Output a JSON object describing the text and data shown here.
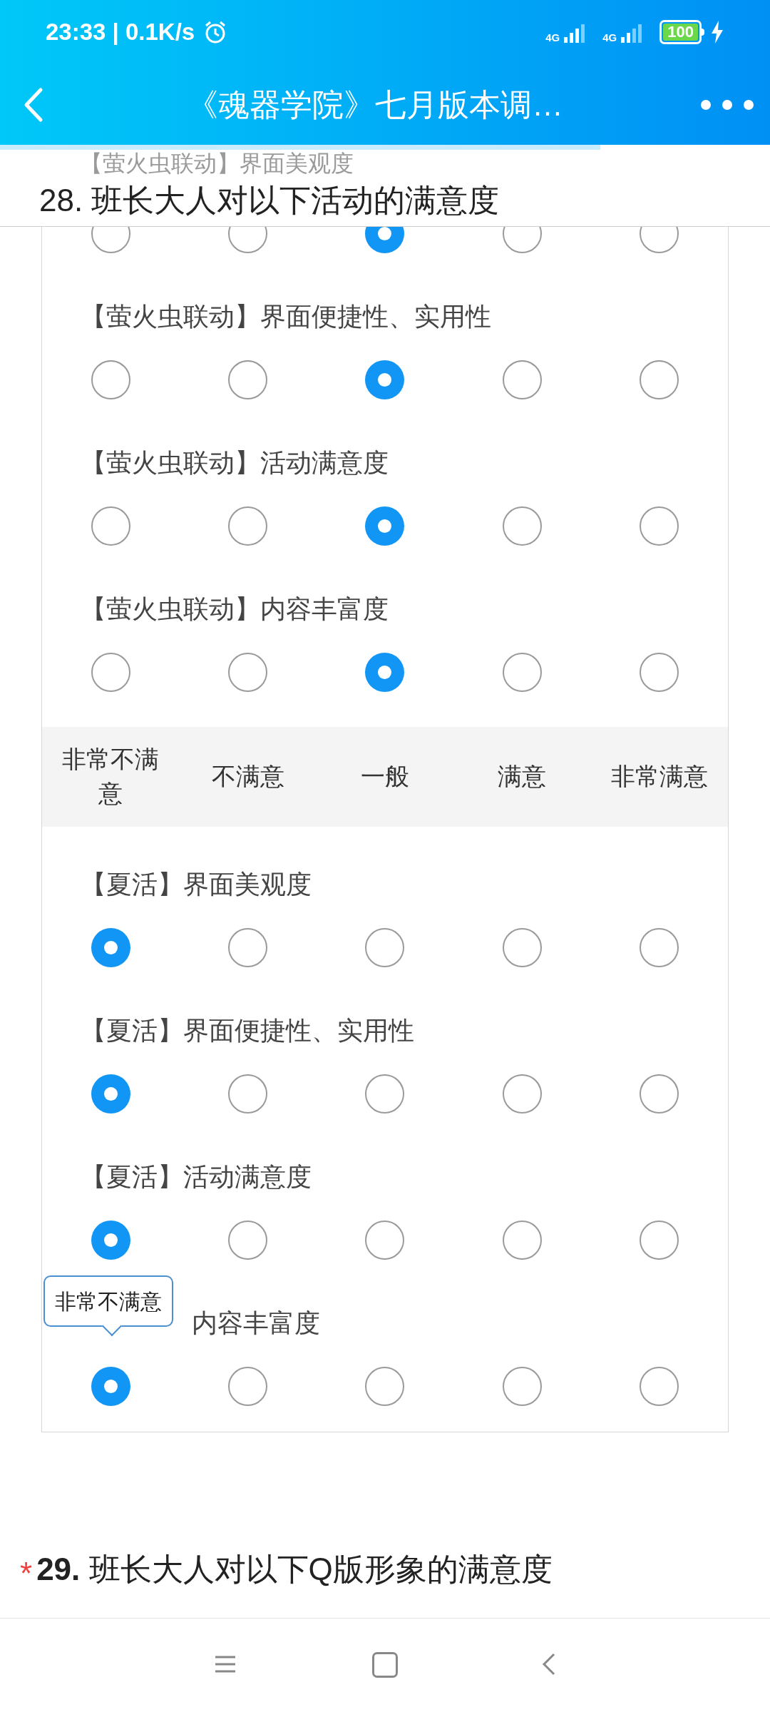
{
  "status_bar": {
    "time": "23:33 | 0.1K/s",
    "network_1": "4G",
    "network_2": "4G",
    "battery": "100"
  },
  "header": {
    "title": "《魂器学院》七月版本调…"
  },
  "progress": {
    "level": 0.78
  },
  "question_28": {
    "title": "28. 班长大人对以下活动的满意度"
  },
  "sections": [
    {
      "items": [
        {
          "label": "【萤火虫联动】界面美观度",
          "options": [
            {
              "selected": false
            },
            {
              "selected": false
            },
            {
              "selected": true
            },
            {
              "selected": false
            },
            {
              "selected": false
            }
          ]
        },
        {
          "label": "【萤火虫联动】界面便捷性、实用性",
          "options": [
            {
              "selected": false
            },
            {
              "selected": false
            },
            {
              "selected": true
            },
            {
              "selected": false
            },
            {
              "selected": false
            }
          ]
        },
        {
          "label": "【萤火虫联动】活动满意度",
          "options": [
            {
              "selected": false
            },
            {
              "selected": false
            },
            {
              "selected": true
            },
            {
              "selected": false
            },
            {
              "selected": false
            }
          ]
        },
        {
          "label": "【萤火虫联动】内容丰富度",
          "options": [
            {
              "selected": false
            },
            {
              "selected": false
            },
            {
              "selected": true
            },
            {
              "selected": false
            },
            {
              "selected": false
            }
          ]
        }
      ]
    },
    {
      "columns": [
        "非常不满意",
        "不满意",
        "一般",
        "满意",
        "非常满意"
      ],
      "items": [
        {
          "label": "【夏活】界面美观度",
          "options": [
            {
              "selected": true
            },
            {
              "selected": false
            },
            {
              "selected": false
            },
            {
              "selected": false
            },
            {
              "selected": false
            }
          ]
        },
        {
          "label": "【夏活】界面便捷性、实用性",
          "options": [
            {
              "selected": true
            },
            {
              "selected": false
            },
            {
              "selected": false
            },
            {
              "selected": false
            },
            {
              "selected": false
            }
          ]
        },
        {
          "label": "【夏活】活动满意度",
          "options": [
            {
              "selected": true
            },
            {
              "selected": false
            },
            {
              "selected": false
            },
            {
              "selected": false
            },
            {
              "selected": false
            }
          ]
        },
        {
          "label": "内容丰富度",
          "tooltip": "非常不满意",
          "options": [
            {
              "selected": true
            },
            {
              "selected": false
            },
            {
              "selected": false
            },
            {
              "selected": false
            },
            {
              "selected": false
            }
          ]
        }
      ]
    }
  ],
  "question_29": {
    "required": true,
    "asterisk": "*",
    "number": "29.",
    "title": "班长大人对以下Q版形象的满意度"
  }
}
